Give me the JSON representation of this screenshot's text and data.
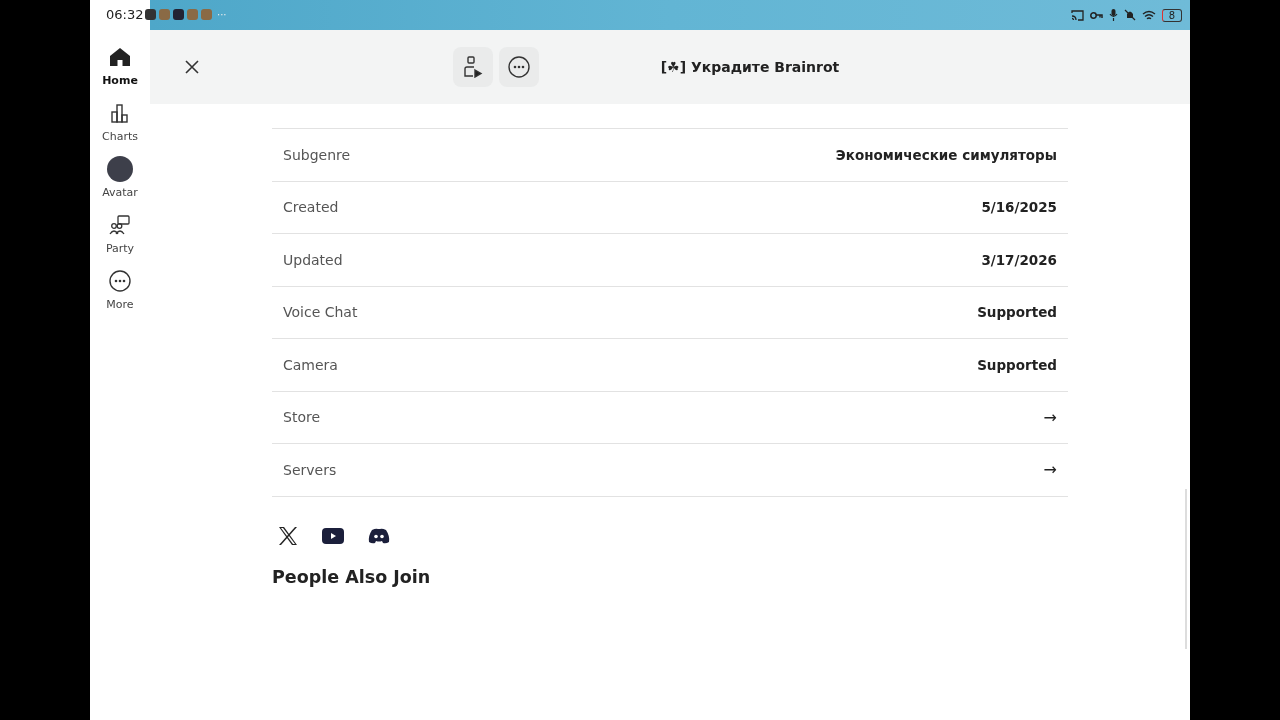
{
  "status_bar": {
    "time": "06:32",
    "overflow": "···",
    "battery": "8"
  },
  "sidebar": {
    "items": [
      {
        "label": "Home",
        "kind": "home",
        "selected": true
      },
      {
        "label": "Charts",
        "kind": "charts",
        "selected": false
      },
      {
        "label": "Avatar",
        "kind": "avatar",
        "selected": false
      },
      {
        "label": "Party",
        "kind": "party",
        "selected": false
      },
      {
        "label": "More",
        "kind": "more",
        "selected": false
      }
    ]
  },
  "header": {
    "title": "[☘] Украдите Brainrot"
  },
  "details": [
    {
      "label": "Subgenre",
      "value": "Экономические симуляторы",
      "kind": "text"
    },
    {
      "label": "Created",
      "value": "5/16/2025",
      "kind": "text"
    },
    {
      "label": "Updated",
      "value": "3/17/2026",
      "kind": "text"
    },
    {
      "label": "Voice Chat",
      "value": "Supported",
      "kind": "text"
    },
    {
      "label": "Camera",
      "value": "Supported",
      "kind": "text"
    },
    {
      "label": "Store",
      "value": "→",
      "kind": "link"
    },
    {
      "label": "Servers",
      "value": "→",
      "kind": "link"
    }
  ],
  "social": [
    {
      "kind": "x"
    },
    {
      "kind": "youtube"
    },
    {
      "kind": "discord"
    }
  ],
  "section_title": "People Also Join"
}
